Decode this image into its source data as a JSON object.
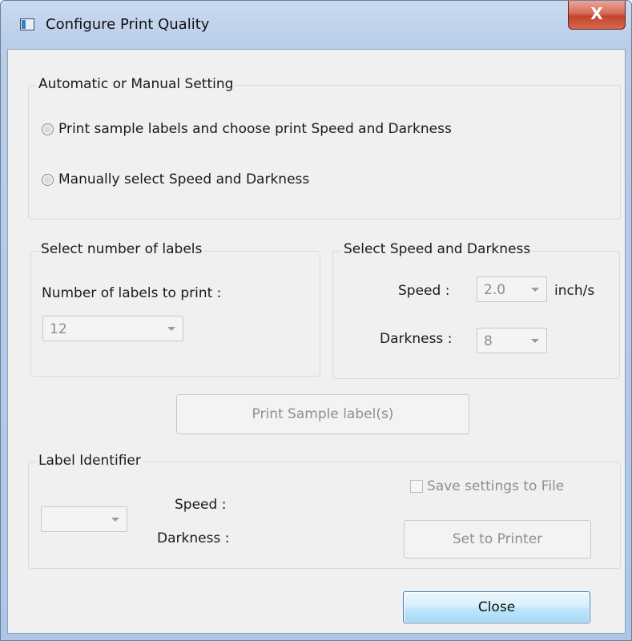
{
  "window": {
    "title": "Configure Print Quality",
    "close_glyph": "X"
  },
  "mode_group": {
    "legend": "Automatic or Manual Setting",
    "options": [
      {
        "label": "Print sample labels and choose print Speed and Darkness",
        "selected": false
      },
      {
        "label": "Manually select Speed and Darkness",
        "selected": false
      }
    ]
  },
  "labels_group": {
    "legend": "Select number of labels",
    "count_label": "Number of labels to print :",
    "count_value": "12"
  },
  "speed_group": {
    "legend": "Select Speed and Darkness",
    "speed_label": "Speed :",
    "speed_value": "2.0",
    "speed_unit": "inch/s",
    "darkness_label": "Darkness :",
    "darkness_value": "8"
  },
  "print_sample_button": "Print Sample label(s)",
  "identifier_group": {
    "legend": "Label Identifier",
    "identifier_value": "",
    "speed_label": "Speed :",
    "darkness_label": "Darkness :",
    "save_checkbox_label": "Save settings to File",
    "save_checked": false,
    "set_button": "Set to Printer"
  },
  "close_button": "Close",
  "colors": {
    "title_gradient_top": "#c9daf0",
    "close_red": "#c4432c",
    "dialog_bg": "#f0f0f0",
    "focus_blue": "#3c7fb1"
  }
}
